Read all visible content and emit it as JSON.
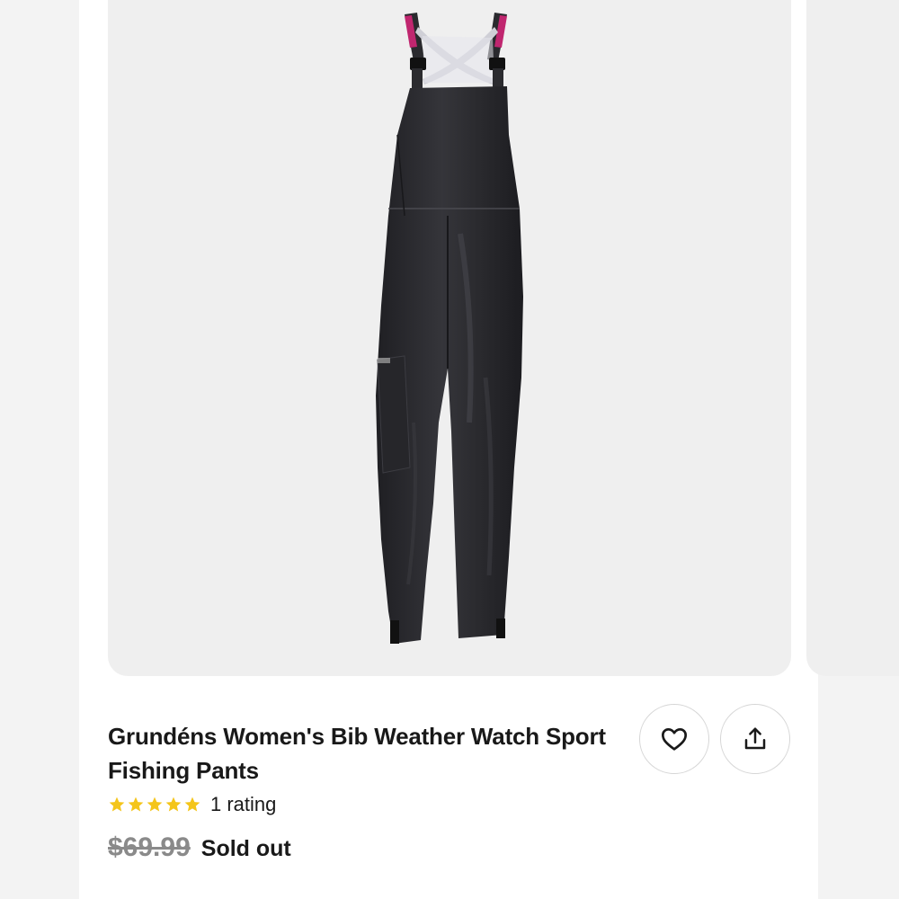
{
  "product": {
    "title": "Grundéns Women's Bib Weather Watch Sport Fishing Pants",
    "image_subject": "black bib fishing overalls with pink crossed straps",
    "rating_stars": 5,
    "rating_label": "1 rating",
    "original_price": "$69.99",
    "status": "Sold out"
  },
  "actions": {
    "watch_icon": "heart-icon",
    "share_icon": "share-icon"
  },
  "colors": {
    "star": "#f4c51a",
    "strap_accent": "#c0266f",
    "fabric": "#2a2a2e"
  }
}
